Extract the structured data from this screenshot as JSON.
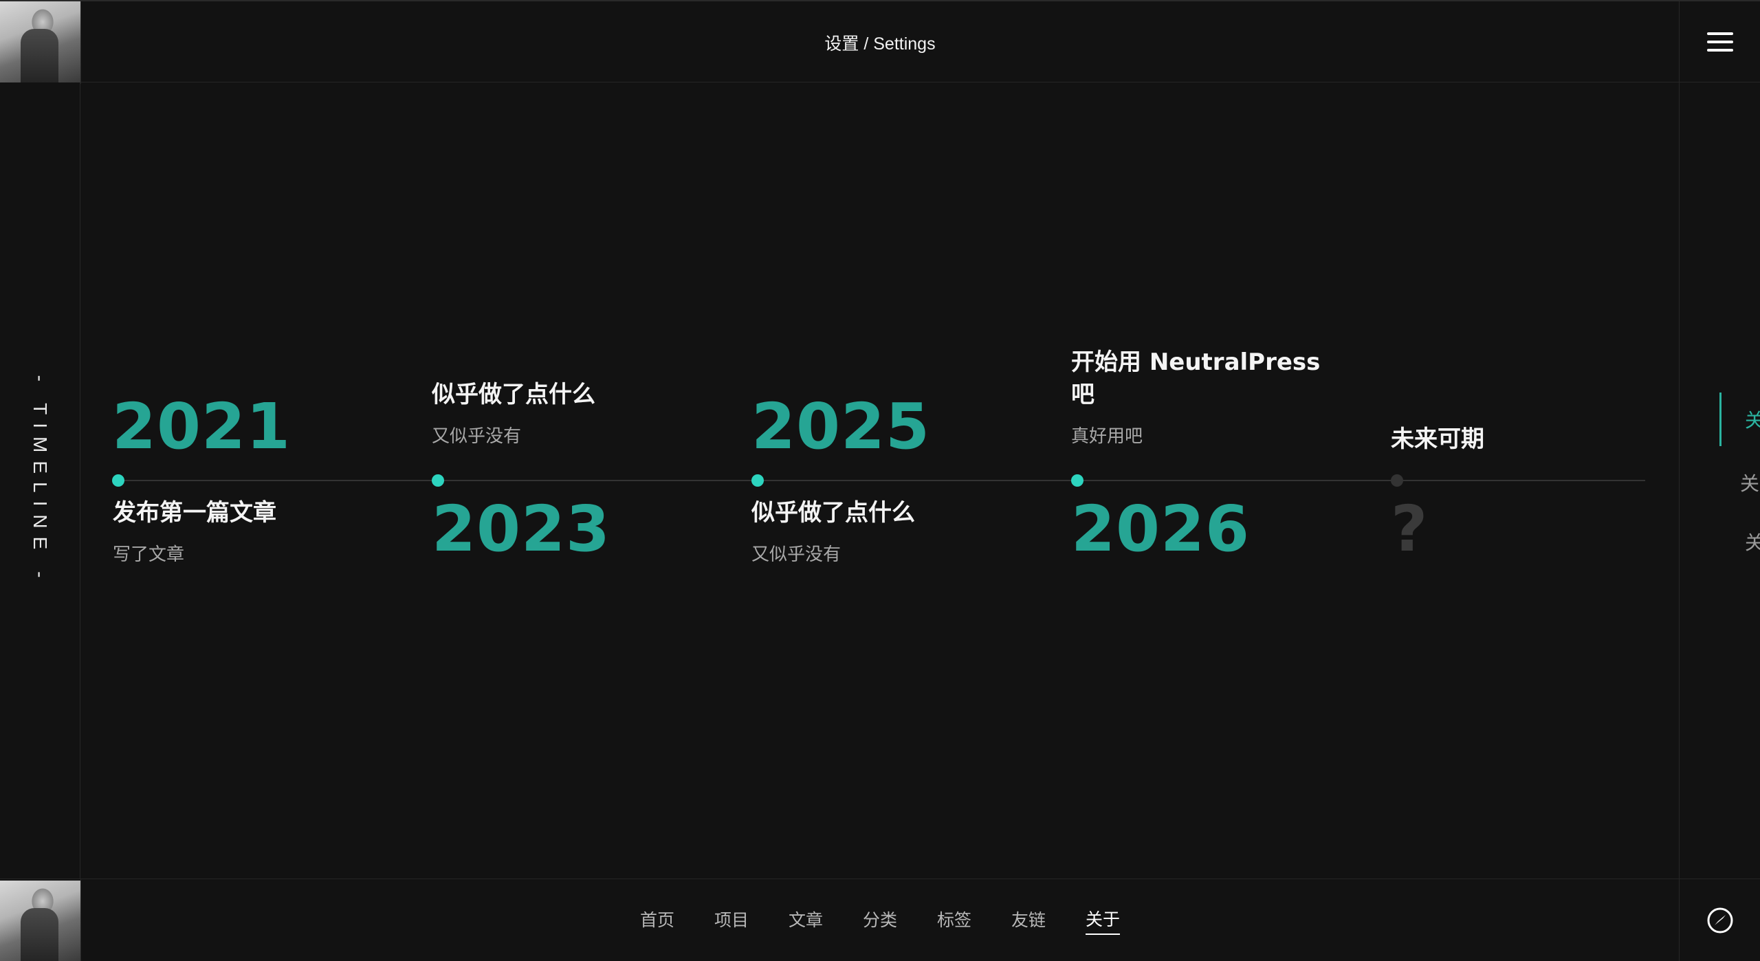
{
  "header": {
    "breadcrumb": "设置 / Settings"
  },
  "left_bar": {
    "label": "- TIMELINE -"
  },
  "timeline": {
    "events": [
      {
        "year": "2021",
        "title": "发布第一篇文章",
        "desc": "写了文章"
      },
      {
        "year": "2023",
        "title": "似乎做了点什么",
        "desc": "又似乎没有"
      },
      {
        "year": "2025",
        "title": "似乎做了点什么",
        "desc": "又似乎没有"
      },
      {
        "year": "2026",
        "title_line1": "开始用 NeutralPress",
        "title_line2": "吧",
        "desc": "真好用吧"
      },
      {
        "year": "?",
        "title": "未来可期"
      }
    ]
  },
  "side_nav": {
    "items": [
      "关",
      "关",
      "关"
    ]
  },
  "footer": {
    "nav": [
      "首页",
      "项目",
      "文章",
      "分类",
      "标签",
      "友链",
      "关于"
    ],
    "active_index": 6
  },
  "colors": {
    "background": "#121212",
    "accent": "#26a594",
    "dot": "#2dd4bf",
    "future": "#3a3a3a"
  }
}
